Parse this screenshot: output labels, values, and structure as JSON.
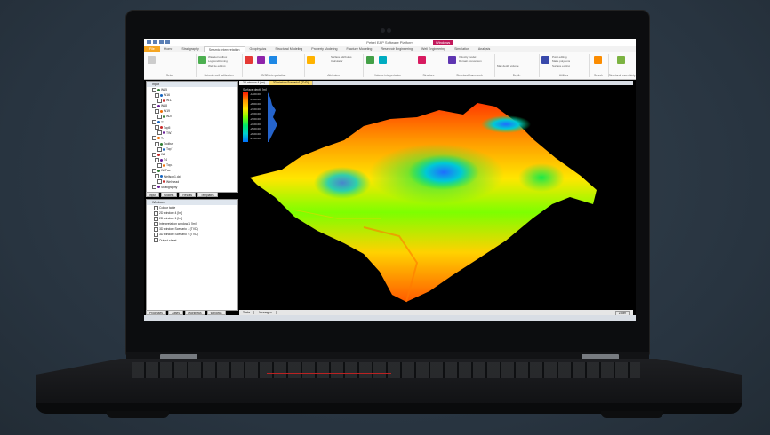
{
  "window": {
    "title": "Petrel E&P Software Platform",
    "badge": "Windows"
  },
  "ribbon": {
    "file_label": "File",
    "tabs": [
      "Home",
      "Stratigraphy",
      "Seismic Interpretation",
      "Geophysics",
      "Structural Modeling",
      "Property Modeling",
      "Fracture Modeling",
      "Reservoir Engineering",
      "Well Engineering",
      "Simulation",
      "Analysis"
    ],
    "selected_tab": "Seismic Interpretation",
    "groups": [
      "Setup",
      "Seismic well calibration",
      "2D/3D interpretation",
      "Attributes",
      "Volume interpretation",
      "Structure",
      "Structural framework",
      "Depth",
      "Utilities",
      "Search",
      "Structural uncertainty"
    ],
    "small_buttons": [
      "Wavelet toolbox",
      "Log conditioning",
      "Well tie editing",
      "Seismic interpretation",
      "Surface attributes",
      "Calculator",
      "Volume attributes",
      "Velocity model",
      "Domain conversion",
      "Max depth volume",
      "Point editing",
      "Make polygons",
      "Surface editing",
      "Edit the workflow",
      "Geobody interpretation",
      "Structural interpretation"
    ]
  },
  "input_panel": {
    "title": "Input",
    "rows": [
      "W15",
      "W16",
      "W17",
      "W18",
      "W19",
      "W20",
      "T3",
      "Top5",
      "TW7",
      "T4",
      "Toolbar",
      "Top7",
      "W3",
      "T4",
      "Top4",
      "Wl/Fac",
      "Wellsop1.dat",
      "Wellhead",
      "Stratigraphy"
    ],
    "bottom_tabs": [
      "Input",
      "Models",
      "Results",
      "Templates"
    ]
  },
  "windows_panel": {
    "title": "Windows",
    "rows": [
      "Colour table",
      "2D window 4 [Im]",
      "2D window 1 [Im]",
      "Interpretation window 1 [Im]",
      "3D window Scenario 1 (TVD)",
      "3D window Scenario 2 (TVD)",
      "Output sheet"
    ],
    "bottom_tabs": [
      "Processes",
      "Cases",
      "Workflows",
      "Windows"
    ]
  },
  "view": {
    "tabs": [
      "3D window 4 (Im)",
      "3D window Scenario1 (TVD)"
    ],
    "selected_tab": "3D window Scenario1 (TVD)",
    "legend_title": "Surface depth [m]",
    "legend_labels": [
      "-1800.00",
      "-1900.00",
      "-2000.00",
      "-2100.00",
      "-2200.00",
      "-2300.00",
      "-2400.00",
      "-2500.00",
      "-2600.00",
      "-2700.00"
    ]
  },
  "statusbar": {
    "tabs": [
      "Tasks",
      "Messages"
    ],
    "zoom": "Zoom"
  },
  "colors": {
    "file_tab": "#f5a623",
    "selected_view_tab": "#f5d76e",
    "badge": "#c2185b"
  }
}
